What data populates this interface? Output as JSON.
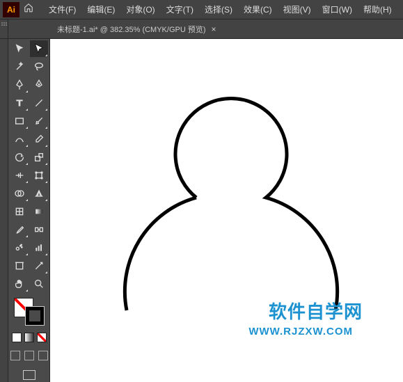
{
  "app": {
    "logo_text": "Ai"
  },
  "menus": {
    "file": "文件(F)",
    "edit": "编辑(E)",
    "object": "对象(O)",
    "type": "文字(T)",
    "select": "选择(S)",
    "effect": "效果(C)",
    "view": "视图(V)",
    "window": "窗口(W)",
    "help": "帮助(H)"
  },
  "tab": {
    "title": "未标题-1.ai* @ 382.35%  (CMYK/GPU 预览)",
    "close": "×"
  },
  "watermark": {
    "line1": "软件自学网",
    "line2": "WWW.RJZXW.COM"
  },
  "tools": {
    "selection": "selection-tool",
    "direct_selection": "direct-selection-tool",
    "magic_wand": "magic-wand-tool",
    "lasso": "lasso-tool",
    "pen": "pen-tool",
    "curvature": "curvature-tool",
    "type": "type-tool",
    "line": "line-segment-tool",
    "rectangle": "rectangle-tool",
    "paintbrush": "paintbrush-tool",
    "shaper": "shaper-tool",
    "eraser": "eraser-tool",
    "rotate": "rotate-tool",
    "scale": "scale-tool",
    "width": "width-tool",
    "free_transform": "free-transform-tool",
    "shape_builder": "shape-builder-tool",
    "perspective": "perspective-grid-tool",
    "mesh": "mesh-tool",
    "gradient": "gradient-tool",
    "eyedropper": "eyedropper-tool",
    "blend": "blend-tool",
    "symbol_sprayer": "symbol-sprayer-tool",
    "column_graph": "column-graph-tool",
    "artboard": "artboard-tool",
    "slice": "slice-tool",
    "hand": "hand-tool",
    "zoom": "zoom-tool"
  }
}
